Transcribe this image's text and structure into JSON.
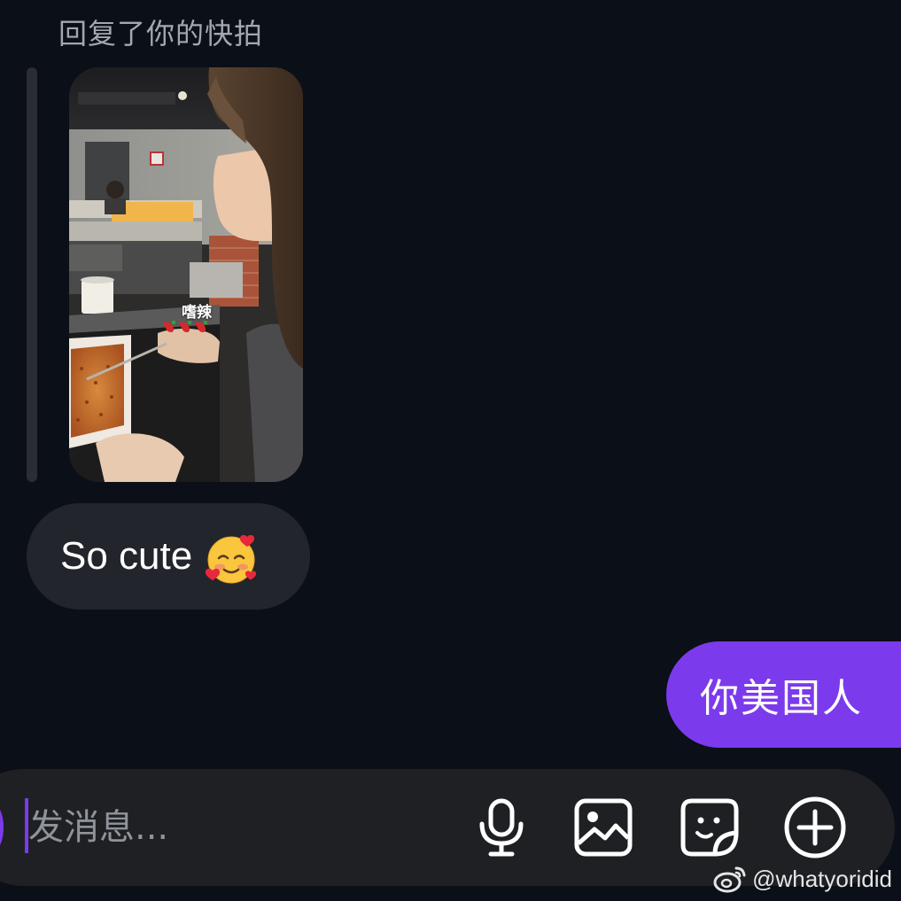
{
  "reply_header": "回复了你的快拍",
  "snap": {
    "caption": "嗜辣"
  },
  "messages": {
    "received": {
      "text": "So cute",
      "emoji_icon": "smiling-face-with-hearts-icon"
    },
    "sent": {
      "text": "你美国人"
    }
  },
  "composer": {
    "placeholder": "发消息...",
    "tools": [
      "microphone-icon",
      "image-icon",
      "sticker-icon",
      "plus-circle-icon"
    ]
  },
  "watermark": {
    "handle": "@whatyoridid",
    "logo": "weibo-logo"
  },
  "colors": {
    "background": "#0b0f17",
    "accent": "#7c3aed",
    "received_bubble": "#22252b",
    "composer_bg": "#1f2024"
  }
}
